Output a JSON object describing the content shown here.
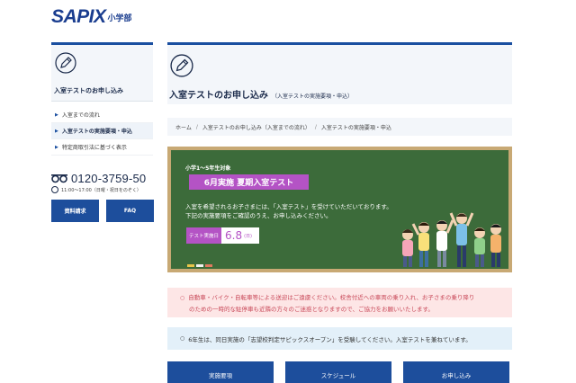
{
  "header": {
    "logo": "SAPIX",
    "logo_sub": "小学部"
  },
  "sidebar": {
    "title": "入室テストのお申し込み",
    "items": [
      {
        "label": "入室までの流れ"
      },
      {
        "label": "入室テストの実施要項・申込"
      },
      {
        "label": "特定商取引法に基づく表示"
      }
    ],
    "phone": "0120-3759-50",
    "hours": "11:00〜17:00（日曜・祝日をのぞく）",
    "btn_docs": "資料請求",
    "btn_faq": "FAQ"
  },
  "main": {
    "title": "入室テストのお申し込み",
    "subtitle": "（入室テストの実施要項・申込）",
    "breadcrumb": [
      "ホーム",
      "入室テストのお申し込み（入室までの流れ）",
      "入室テストの実施要項・申込"
    ],
    "board": {
      "grade": "小学1〜5年生対象",
      "banner": "6月実施 夏期入室テスト",
      "line1": "入室を希望されるお子さまには、「入室テスト」を受けていただいております。",
      "line2": "下記の実施要項をご確認のうえ、お申し込みください。",
      "date_label": "テスト実施日",
      "date": "6.8",
      "dow": "(日)"
    },
    "note_red_1": "自動車・バイク・自転車等による送迎はご遠慮ください。校舎付近への車両の乗り入れ、お子さまの乗り降り",
    "note_red_2": "のための一時的な駐停車も近隣の方々のご迷惑となりますので、ご協力をお願いいたします。",
    "note_blue": "6年生は、同日実施の「志望校判定サピックスオープン」を受験してください。入室テストを兼ねています。",
    "buttons": [
      "実施要項",
      "スケジュール",
      "お申し込み"
    ]
  },
  "colors": {
    "brand": "#1a4fa0",
    "button": "#1d4e9c",
    "accent": "#b453c5",
    "board": "#3c6b3a",
    "frame": "#c8a974"
  }
}
